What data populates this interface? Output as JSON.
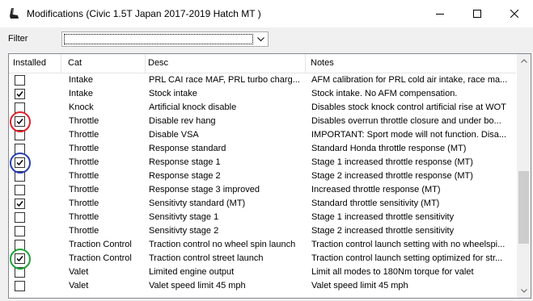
{
  "window": {
    "title": "Modifications (Civic 1.5T Japan 2017-2019 Hatch MT )",
    "icon": "seat-icon"
  },
  "filter": {
    "label": "Filter",
    "value": ""
  },
  "columns": [
    "Installed",
    "Cat",
    "Desc",
    "Notes"
  ],
  "rows": [
    {
      "installed": false,
      "cat": "Intake",
      "desc": "PRL CAI race MAF, PRL turbo charg...",
      "notes": "AFM calibration for PRL cold air intake, race ma..."
    },
    {
      "installed": true,
      "cat": "Intake",
      "desc": "Stock intake",
      "notes": "Stock intake. No AFM compensation."
    },
    {
      "installed": false,
      "cat": "Knock",
      "desc": "Artificial knock disable",
      "notes": "Disables stock knock control artificial rise at WOT"
    },
    {
      "installed": true,
      "cat": "Throttle",
      "desc": "Disable rev hang",
      "notes": "Disables overrun throttle closure and under bo..."
    },
    {
      "installed": false,
      "cat": "Throttle",
      "desc": "Disable VSA",
      "notes": "IMPORTANT: Sport mode will not function. Disa..."
    },
    {
      "installed": false,
      "cat": "Throttle",
      "desc": "Response  standard",
      "notes": "Standard Honda throttle response (MT)"
    },
    {
      "installed": true,
      "cat": "Throttle",
      "desc": "Response stage 1",
      "notes": "Stage 1 increased throttle response (MT)"
    },
    {
      "installed": false,
      "cat": "Throttle",
      "desc": "Response stage 2",
      "notes": "Stage 2 increased throttle response (MT)"
    },
    {
      "installed": false,
      "cat": "Throttle",
      "desc": "Response stage 3 improved",
      "notes": "Increased throttle response (MT)"
    },
    {
      "installed": true,
      "cat": "Throttle",
      "desc": "Sensitivty  standard (MT)",
      "notes": "Standard throttle sensitivity (MT)"
    },
    {
      "installed": false,
      "cat": "Throttle",
      "desc": "Sensitivty stage 1",
      "notes": "Stage 1 increased throttle sensitivity"
    },
    {
      "installed": false,
      "cat": "Throttle",
      "desc": "Sensitivty stage 2",
      "notes": "Stage 2 increased throttle sensitivity"
    },
    {
      "installed": false,
      "cat": "Traction Control",
      "desc": "Traction control no wheel spin launch",
      "notes": "Traction control launch setting with no wheelspi..."
    },
    {
      "installed": true,
      "cat": "Traction Control",
      "desc": "Traction control street launch",
      "notes": "Traction control launch setting optimized for str..."
    },
    {
      "installed": false,
      "cat": "Valet",
      "desc": "Limited engine output",
      "notes": "Limit all modes to 180Nm torque for valet"
    },
    {
      "installed": false,
      "cat": "Valet",
      "desc": "Valet speed limit 45 mph",
      "notes": "Valet speed limit 45 mph"
    }
  ],
  "annotations": [
    {
      "row": 3,
      "color": "#e0202a"
    },
    {
      "row": 6,
      "color": "#2a3fb0"
    },
    {
      "row": 13,
      "color": "#1fa33a"
    }
  ],
  "scrollbar": {
    "position": 0.72
  }
}
